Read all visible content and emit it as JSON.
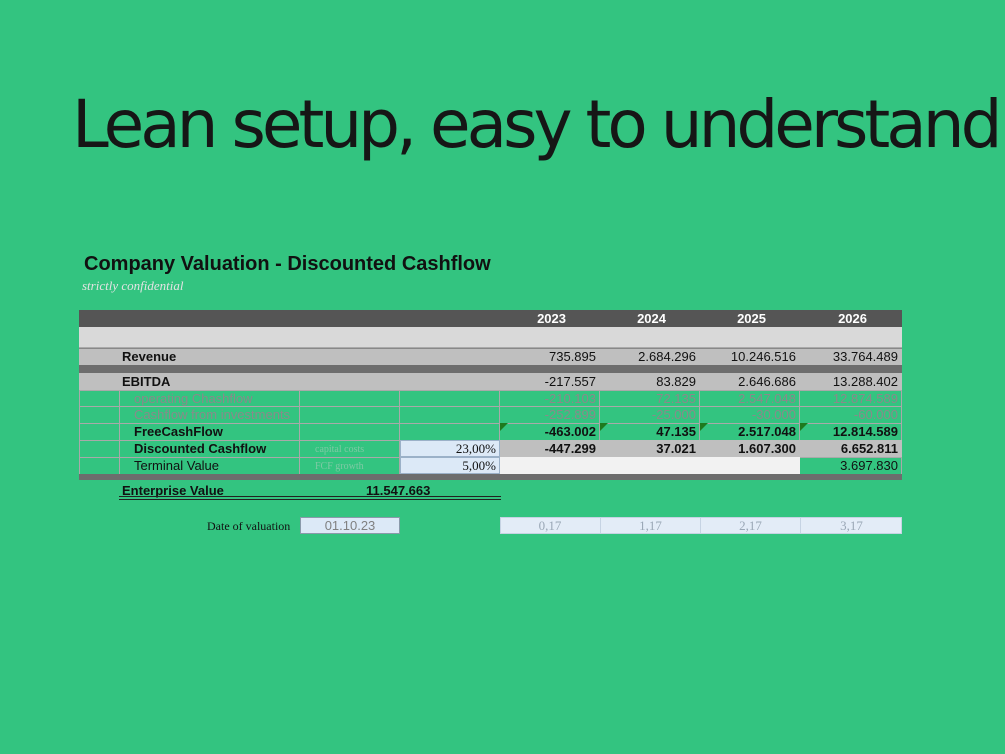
{
  "slide": {
    "title": "Lean setup, easy to understand"
  },
  "sheet": {
    "title": "Company Valuation - Discounted Cashflow",
    "subtitle": "strictly confidential",
    "years": [
      "2023",
      "2024",
      "2025",
      "2026"
    ],
    "revenue": {
      "label": "Revenue",
      "values": [
        "735.895",
        "2.684.296",
        "10.246.516",
        "33.764.489"
      ]
    },
    "ebitda": {
      "label": "EBITDA",
      "values": [
        "-217.557",
        "83.829",
        "2.646.686",
        "13.288.402"
      ]
    },
    "operating": {
      "label": "operating Chashflow",
      "values": [
        "-210.103",
        "72.135",
        "2.547.048",
        "12.874.589"
      ]
    },
    "investments": {
      "label": "Cashflow from investments",
      "values": [
        "-252.899",
        "-25.000",
        "-30.000",
        "-60.000"
      ]
    },
    "fcf": {
      "label": "FreeCashFlow",
      "values": [
        "-463.002",
        "47.135",
        "2.517.048",
        "12.814.589"
      ]
    },
    "dcf": {
      "label": "Discounted Cashflow",
      "param_label": "capital costs",
      "param_value": "23,00%",
      "values": [
        "-447.299",
        "37.021",
        "1.607.300",
        "6.652.811"
      ]
    },
    "terminal": {
      "label": "Terminal Value",
      "param_label": "FCF growth",
      "param_value": "5,00%",
      "value": "3.697.830"
    },
    "enterprise": {
      "label": "Enterprise Value",
      "value": "11.547.663"
    },
    "valuation": {
      "label": "Date of valuation",
      "date": "01.10.23",
      "factors": [
        "0,17",
        "1,17",
        "2,17",
        "3,17"
      ]
    },
    "colors": {
      "background": "#33c480",
      "header": "#555555",
      "triangle": "#1e7a1e"
    }
  }
}
